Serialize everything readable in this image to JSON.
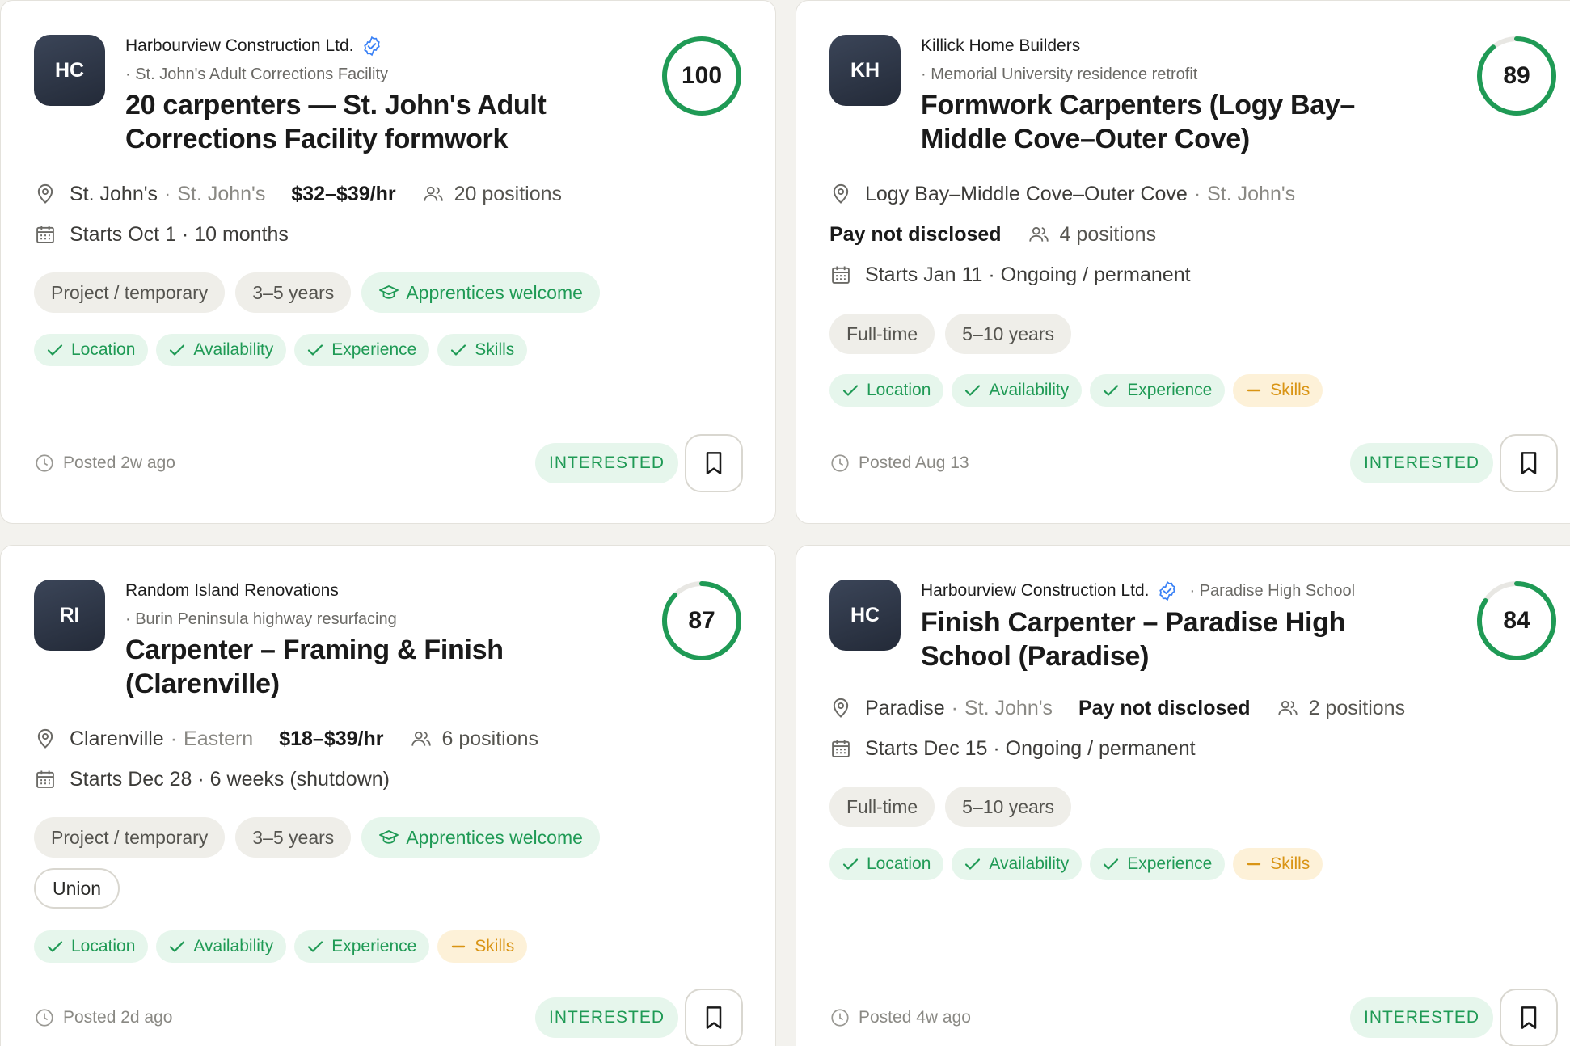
{
  "colors": {
    "accent_green": "#1f9a55",
    "warn_amber": "#d99414",
    "ring_track": "#e8e7e3"
  },
  "cards": [
    {
      "initials": "HC",
      "company": "Harbourview Construction Ltd.",
      "verified": true,
      "project": "· St. John's Adult Corrections Facility",
      "title": "20 carpenters — St. John's Adult Corrections Facility formwork",
      "score": "100",
      "score_fraction": 1.0,
      "location": "St. John's",
      "region": "St. John's",
      "pay": "$32–$39/hr",
      "positions": "20 positions",
      "start": "Starts Oct 1 · 10 months",
      "tags": [
        "Project / temporary",
        "3–5 years",
        "Apprentices welcome"
      ],
      "checks": [
        {
          "label": "Location",
          "status": "ok"
        },
        {
          "label": "Availability",
          "status": "ok"
        },
        {
          "label": "Experience",
          "status": "ok"
        },
        {
          "label": "Skills",
          "status": "ok"
        }
      ],
      "posted": "Posted 2w ago",
      "interested": "INTERESTED"
    },
    {
      "initials": "KH",
      "company": "Killick Home Builders",
      "verified": false,
      "project": "· Memorial University residence retrofit",
      "title": "Formwork Carpenters (Logy Bay–Middle Cove–Outer Cove)",
      "score": "89",
      "score_fraction": 0.89,
      "location": "Logy Bay–Middle Cove–Outer Cove",
      "region": "St. John's",
      "pay": "Pay not disclosed",
      "positions": "4 positions",
      "start": "Starts Jan 11 · Ongoing / permanent",
      "tags": [
        "Full-time",
        "5–10 years"
      ],
      "checks": [
        {
          "label": "Location",
          "status": "ok"
        },
        {
          "label": "Availability",
          "status": "ok"
        },
        {
          "label": "Experience",
          "status": "ok"
        },
        {
          "label": "Skills",
          "status": "warn"
        }
      ],
      "posted": "Posted Aug 13",
      "interested": "INTERESTED"
    },
    {
      "initials": "RI",
      "company": "Random Island Renovations",
      "verified": false,
      "project": "· Burin Peninsula highway resurfacing",
      "title": "Carpenter – Framing & Finish (Clarenville)",
      "score": "87",
      "score_fraction": 0.87,
      "location": "Clarenville",
      "region": "Eastern",
      "pay": "$18–$39/hr",
      "positions": "6 positions",
      "start": "Starts Dec 28 · 6 weeks (shutdown)",
      "tags": [
        "Project / temporary",
        "3–5 years",
        "Apprentices welcome",
        "Union"
      ],
      "checks": [
        {
          "label": "Location",
          "status": "ok"
        },
        {
          "label": "Availability",
          "status": "ok"
        },
        {
          "label": "Experience",
          "status": "ok"
        },
        {
          "label": "Skills",
          "status": "warn"
        }
      ],
      "posted": "Posted 2d ago",
      "interested": "INTERESTED"
    },
    {
      "initials": "HC",
      "company": "Harbourview Construction Ltd.",
      "verified": true,
      "project": "· Paradise High School",
      "title": "Finish Carpenter – Paradise High School (Paradise)",
      "score": "84",
      "score_fraction": 0.84,
      "location": "Paradise",
      "region": "St. John's",
      "pay": "Pay not disclosed",
      "positions": "2 positions",
      "start": "Starts Dec 15 · Ongoing / permanent",
      "tags": [
        "Full-time",
        "5–10 years"
      ],
      "checks": [
        {
          "label": "Location",
          "status": "ok"
        },
        {
          "label": "Availability",
          "status": "ok"
        },
        {
          "label": "Experience",
          "status": "ok"
        },
        {
          "label": "Skills",
          "status": "warn"
        }
      ],
      "posted": "Posted 4w ago",
      "interested": "INTERESTED"
    }
  ]
}
